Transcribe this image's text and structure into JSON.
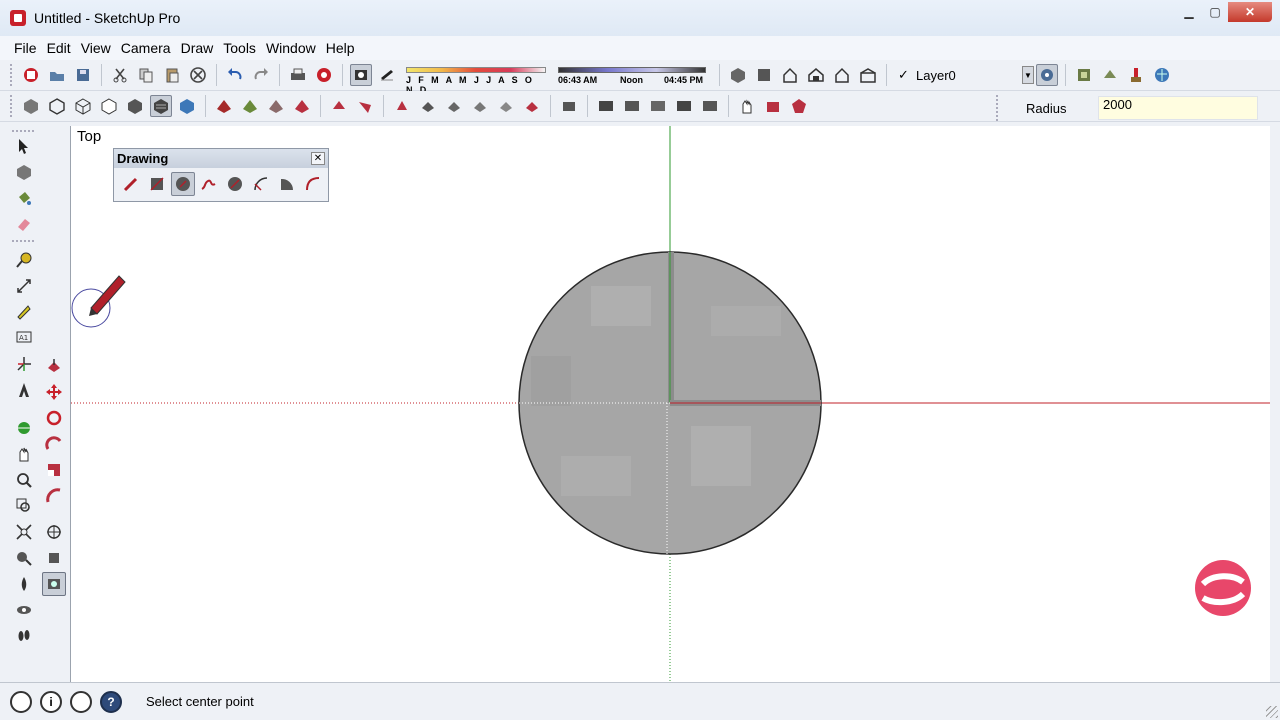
{
  "window": {
    "title": "Untitled - SketchUp Pro",
    "min": "▁",
    "max": "▢",
    "close": "✕"
  },
  "menu": [
    "File",
    "Edit",
    "View",
    "Camera",
    "Draw",
    "Tools",
    "Window",
    "Help"
  ],
  "toolbar1": {
    "shadow_months": "J F M A M J J A S O N D",
    "shadow_times": [
      "06:43 AM",
      "Noon",
      "04:45 PM"
    ],
    "layer": {
      "check": "✓",
      "name": "Layer0",
      "dropdown": "▼"
    }
  },
  "vcb": {
    "label": "Radius",
    "value": "2000"
  },
  "viewport": {
    "view_label": "Top"
  },
  "drawing_panel": {
    "title": "Drawing",
    "close": "✕",
    "tools": [
      "line-icon",
      "rectangle-icon",
      "circle-icon",
      "freehand-icon",
      "polygon-icon",
      "arc-icon",
      "pie-icon",
      "arc-2pt-icon"
    ],
    "selected": "circle-icon"
  },
  "colors": {
    "red_axis": "#c0202a",
    "green_axis": "#2f9a2f",
    "circle_fill": "#a6a6a6",
    "brand_pink": "#e8476a"
  },
  "statusbar": {
    "message": "Select center point",
    "help_glyph": "?",
    "info_glyph": "i"
  }
}
